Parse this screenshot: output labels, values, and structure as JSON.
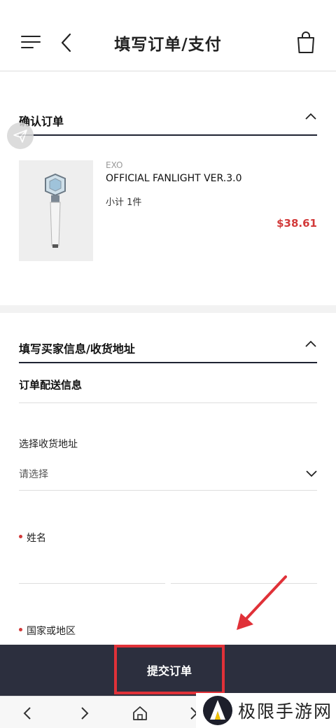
{
  "header": {
    "title": "填写订单/支付"
  },
  "confirm_section": {
    "title": "确认订单",
    "item": {
      "brand": "EXO",
      "name": "OFFICIAL FANLIGHT VER.3.0",
      "quantity": "小计 1件",
      "price": "$38.61"
    }
  },
  "buyer_section": {
    "title": "填写买家信息/收货地址",
    "subtitle": "订单配送信息",
    "address_label": "选择收货地址",
    "address_value": "请选择",
    "name_label": "姓名",
    "country_label": "国家或地区"
  },
  "bottom": {
    "submit_label": "提交订单"
  },
  "watermark": {
    "text": "极限手游网"
  },
  "colors": {
    "accent_red": "#d23a3a",
    "bar_dark": "#2c2f3e",
    "annotation_red": "#e03138"
  }
}
